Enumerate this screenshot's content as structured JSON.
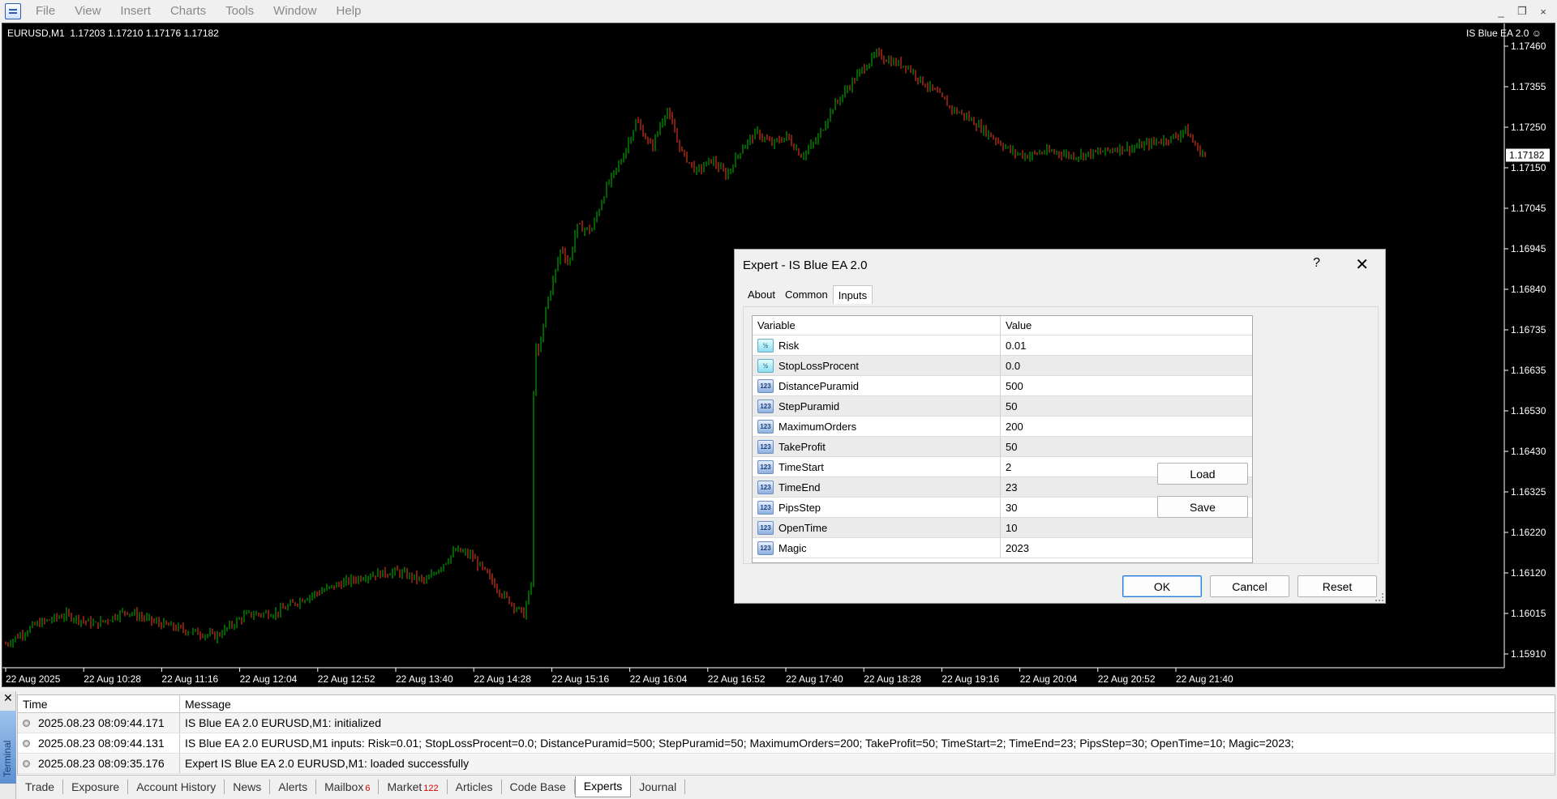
{
  "menu": {
    "items": [
      "File",
      "View",
      "Insert",
      "Charts",
      "Tools",
      "Window",
      "Help"
    ],
    "window_controls": [
      "_",
      "❐",
      "×"
    ]
  },
  "chart": {
    "info": "EURUSD,M1  1.17203 1.17210 1.17176 1.17182",
    "ea_label": "IS Blue EA 2.0",
    "ea_icon": "smiley-icon",
    "price_levels": [
      "1.17460",
      "1.17355",
      "1.17250",
      "1.17150",
      "1.17045",
      "1.16945",
      "1.16840",
      "1.16735",
      "1.16635",
      "1.16530",
      "1.16430",
      "1.16325",
      "1.16220",
      "1.16120",
      "1.16015",
      "1.15910"
    ],
    "current_price": "1.17182",
    "time_labels": [
      "22 Aug 2025",
      "22 Aug 10:28",
      "22 Aug 11:16",
      "22 Aug 12:04",
      "22 Aug 12:52",
      "22 Aug 13:40",
      "22 Aug 14:28",
      "22 Aug 15:16",
      "22 Aug 16:04",
      "22 Aug 16:52",
      "22 Aug 17:40",
      "22 Aug 18:28",
      "22 Aug 19:16",
      "22 Aug 20:04",
      "22 Aug 20:52",
      "22 Aug 21:40"
    ],
    "colors": {
      "background": "#000000",
      "bull": "#00c000",
      "bear": "#ff3b1f"
    },
    "price_path": [
      [
        0,
        1.15935
      ],
      [
        0.02,
        1.15985
      ],
      [
        0.04,
        1.1601
      ],
      [
        0.06,
        1.15985
      ],
      [
        0.08,
        1.1602
      ],
      [
        0.1,
        1.1599
      ],
      [
        0.12,
        1.1597
      ],
      [
        0.14,
        1.15955
      ],
      [
        0.16,
        1.1601
      ],
      [
        0.18,
        1.16015
      ],
      [
        0.2,
        1.16055
      ],
      [
        0.22,
        1.16085
      ],
      [
        0.24,
        1.1611
      ],
      [
        0.26,
        1.1612
      ],
      [
        0.28,
        1.16095
      ],
      [
        0.3,
        1.16175
      ],
      [
        0.31,
        1.1616
      ],
      [
        0.32,
        1.16115
      ],
      [
        0.33,
        1.16065
      ],
      [
        0.345,
        1.1601
      ],
      [
        0.35,
        1.1609
      ],
      [
        0.352,
        1.1672
      ],
      [
        0.355,
        1.1667
      ],
      [
        0.36,
        1.168
      ],
      [
        0.365,
        1.1687
      ],
      [
        0.37,
        1.1695
      ],
      [
        0.375,
        1.169
      ],
      [
        0.38,
        1.17
      ],
      [
        0.39,
        1.1699
      ],
      [
        0.4,
        1.171
      ],
      [
        0.41,
        1.1717
      ],
      [
        0.42,
        1.1727
      ],
      [
        0.43,
        1.172
      ],
      [
        0.44,
        1.173
      ],
      [
        0.45,
        1.1719
      ],
      [
        0.46,
        1.1714
      ],
      [
        0.47,
        1.1717
      ],
      [
        0.48,
        1.1713
      ],
      [
        0.49,
        1.172
      ],
      [
        0.5,
        1.1724
      ],
      [
        0.51,
        1.1721
      ],
      [
        0.52,
        1.1723
      ],
      [
        0.53,
        1.1718
      ],
      [
        0.54,
        1.1722
      ],
      [
        0.55,
        1.173
      ],
      [
        0.56,
        1.1735
      ],
      [
        0.57,
        1.174
      ],
      [
        0.58,
        1.1744
      ],
      [
        0.59,
        1.1742
      ],
      [
        0.6,
        1.1741
      ],
      [
        0.61,
        1.1737
      ],
      [
        0.62,
        1.1734
      ],
      [
        0.63,
        1.173
      ],
      [
        0.64,
        1.1728
      ],
      [
        0.65,
        1.1725
      ],
      [
        0.66,
        1.1722
      ],
      [
        0.67,
        1.1719
      ],
      [
        0.68,
        1.1718
      ],
      [
        0.69,
        1.1719
      ],
      [
        0.7,
        1.1719
      ],
      [
        0.71,
        1.1718
      ],
      [
        0.72,
        1.17185
      ],
      [
        0.73,
        1.1719
      ],
      [
        0.74,
        1.172
      ],
      [
        0.75,
        1.172
      ],
      [
        0.76,
        1.1721
      ],
      [
        0.77,
        1.1722
      ],
      [
        0.78,
        1.1723
      ],
      [
        0.785,
        1.1725
      ],
      [
        0.79,
        1.1722
      ],
      [
        0.795,
        1.1719
      ],
      [
        0.8,
        1.17182
      ]
    ]
  },
  "dialog": {
    "title": "Expert - IS Blue EA 2.0",
    "help": "?",
    "close": "✕",
    "tabs": [
      "About",
      "Common",
      "Inputs"
    ],
    "columns": {
      "variable": "Variable",
      "value": "Value"
    },
    "inputs": [
      {
        "name": "Risk",
        "value": "0.01",
        "icon": "double-icon",
        "badge": "½"
      },
      {
        "name": "StopLossProcent",
        "value": "0.0",
        "icon": "double-icon",
        "badge": "½"
      },
      {
        "name": "DistancePuramid",
        "value": "500",
        "icon": "integer-icon",
        "badge": "123"
      },
      {
        "name": "StepPuramid",
        "value": "50",
        "icon": "integer-icon",
        "badge": "123"
      },
      {
        "name": "MaximumOrders",
        "value": "200",
        "icon": "integer-icon",
        "badge": "123"
      },
      {
        "name": "TakeProfit",
        "value": "50",
        "icon": "integer-icon",
        "badge": "123"
      },
      {
        "name": "TimeStart",
        "value": "2",
        "icon": "integer-icon",
        "badge": "123"
      },
      {
        "name": "TimeEnd",
        "value": "23",
        "icon": "integer-icon",
        "badge": "123"
      },
      {
        "name": "PipsStep",
        "value": "30",
        "icon": "integer-icon",
        "badge": "123"
      },
      {
        "name": "OpenTime",
        "value": "10",
        "icon": "integer-icon",
        "badge": "123"
      },
      {
        "name": "Magic",
        "value": "2023",
        "icon": "integer-icon",
        "badge": "123"
      }
    ],
    "buttons": {
      "load": "Load",
      "save": "Save",
      "ok": "OK",
      "cancel": "Cancel",
      "reset": "Reset"
    }
  },
  "terminal": {
    "label": "Terminal",
    "close": "✕",
    "columns": {
      "time": "Time",
      "message": "Message"
    },
    "rows": [
      {
        "time": "2025.08.23 08:09:44.171",
        "message": "IS Blue EA 2.0 EURUSD,M1: initialized"
      },
      {
        "time": "2025.08.23 08:09:44.131",
        "message": "IS Blue EA 2.0 EURUSD,M1 inputs: Risk=0.01; StopLossProcent=0.0; DistancePuramid=500; StepPuramid=50; MaximumOrders=200; TakeProfit=50; TimeStart=2; TimeEnd=23; PipsStep=30; OpenTime=10; Magic=2023;"
      },
      {
        "time": "2025.08.23 08:09:35.176",
        "message": "Expert IS Blue EA 2.0 EURUSD,M1: loaded successfully"
      }
    ],
    "tabs": [
      {
        "label": "Trade",
        "badge": ""
      },
      {
        "label": "Exposure",
        "badge": ""
      },
      {
        "label": "Account History",
        "badge": ""
      },
      {
        "label": "News",
        "badge": ""
      },
      {
        "label": "Alerts",
        "badge": ""
      },
      {
        "label": "Mailbox",
        "badge": "6"
      },
      {
        "label": "Market",
        "badge": "122"
      },
      {
        "label": "Articles",
        "badge": ""
      },
      {
        "label": "Code Base",
        "badge": ""
      },
      {
        "label": "Experts",
        "badge": "",
        "active": true
      },
      {
        "label": "Journal",
        "badge": ""
      }
    ]
  }
}
